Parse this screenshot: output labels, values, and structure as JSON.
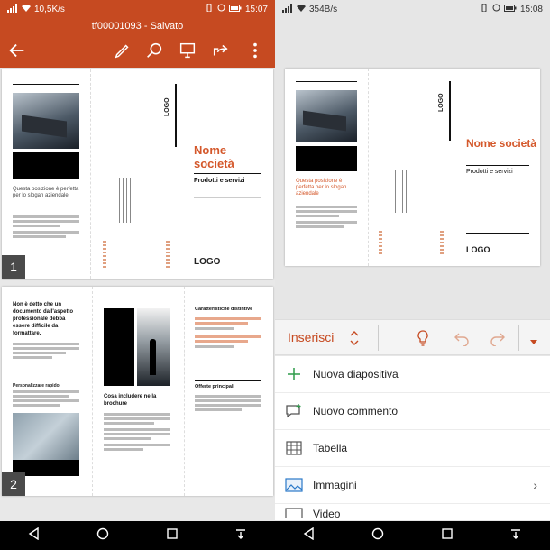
{
  "left": {
    "status": {
      "speed": "10,5K/s",
      "time": "15:07"
    },
    "doc_title": "tf00001093 - Salvato",
    "slide1": {
      "number": "1",
      "slogan": "Questa posizione è perfetta per lo slogan aziendale",
      "company_name": "Nome società",
      "products": "Prodotti e servizi",
      "logo_small": "LOGO"
    },
    "slide2": {
      "number": "2",
      "headline": "Non è detto che un documento dall'aspetto professionale debba essere difficile da formattare.",
      "section_title": "Cosa includere nella brochure",
      "features_title": "Caratteristiche distintive",
      "offers_title": "Offerte principali",
      "sub_heading": "Personalizzare rapido"
    }
  },
  "right": {
    "status": {
      "speed": "354B/s",
      "time": "15:08"
    },
    "slide1": {
      "slogan": "Questa posizione è perfetta per lo slogan aziendale",
      "company_name": "Nome società",
      "products": "Prodotti e servizi",
      "logo": "LOGO"
    },
    "ribbon": {
      "tab_label": "Inserisci"
    },
    "menu": [
      {
        "label": "Nuova diapositiva",
        "icon": "plus-icon"
      },
      {
        "label": "Nuovo commento",
        "icon": "comment-icon"
      },
      {
        "label": "Tabella",
        "icon": "table-icon"
      },
      {
        "label": "Immagini",
        "icon": "image-icon"
      },
      {
        "label": "Video",
        "icon": "video-icon"
      }
    ]
  },
  "colors": {
    "accent": "#c64a21",
    "orange_text": "#d4582b"
  }
}
